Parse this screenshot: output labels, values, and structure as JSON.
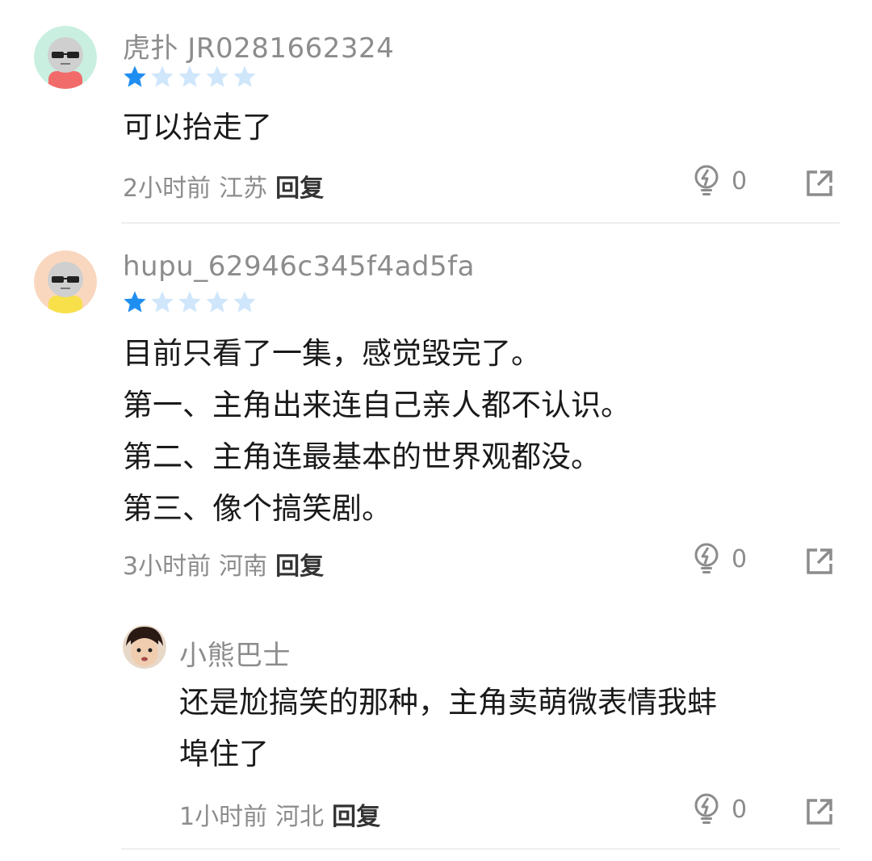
{
  "comments": [
    {
      "username": "虎扑 JR0281662324",
      "rating": 1,
      "rating_max": 5,
      "lines": [
        "可以抬走了"
      ],
      "time": "2小时前",
      "region": "江苏",
      "reply_label": "回复",
      "likes": "0",
      "avatar_icon": "gray-bald-avatar-red-shirt",
      "share_icon": "share-icon"
    },
    {
      "username": "hupu_62946c345f4ad5fa",
      "rating": 1,
      "rating_max": 5,
      "lines": [
        "目前只看了一集，感觉毁完了。",
        "第一、主角出来连自己亲人都不认识。",
        "第二、主角连最基本的世界观都没。",
        "第三、像个搞笑剧。"
      ],
      "time": "3小时前",
      "region": "河南",
      "reply_label": "回复",
      "likes": "0",
      "avatar_icon": "gray-bald-avatar-yellow-shirt",
      "share_icon": "share-icon"
    }
  ],
  "reply": {
    "username": "小熊巴士",
    "lines": [
      "还是尬搞笑的那种，主角卖萌微表情我蚌",
      "埠住了"
    ],
    "time": "1小时前",
    "region": "河北",
    "reply_label": "回复",
    "likes": "0"
  },
  "colors": {
    "star_filled": "#1f8ef1",
    "star_empty": "#cfe6fb",
    "meta_gray": "#8c8c8c",
    "divider": "#eeeeee"
  }
}
